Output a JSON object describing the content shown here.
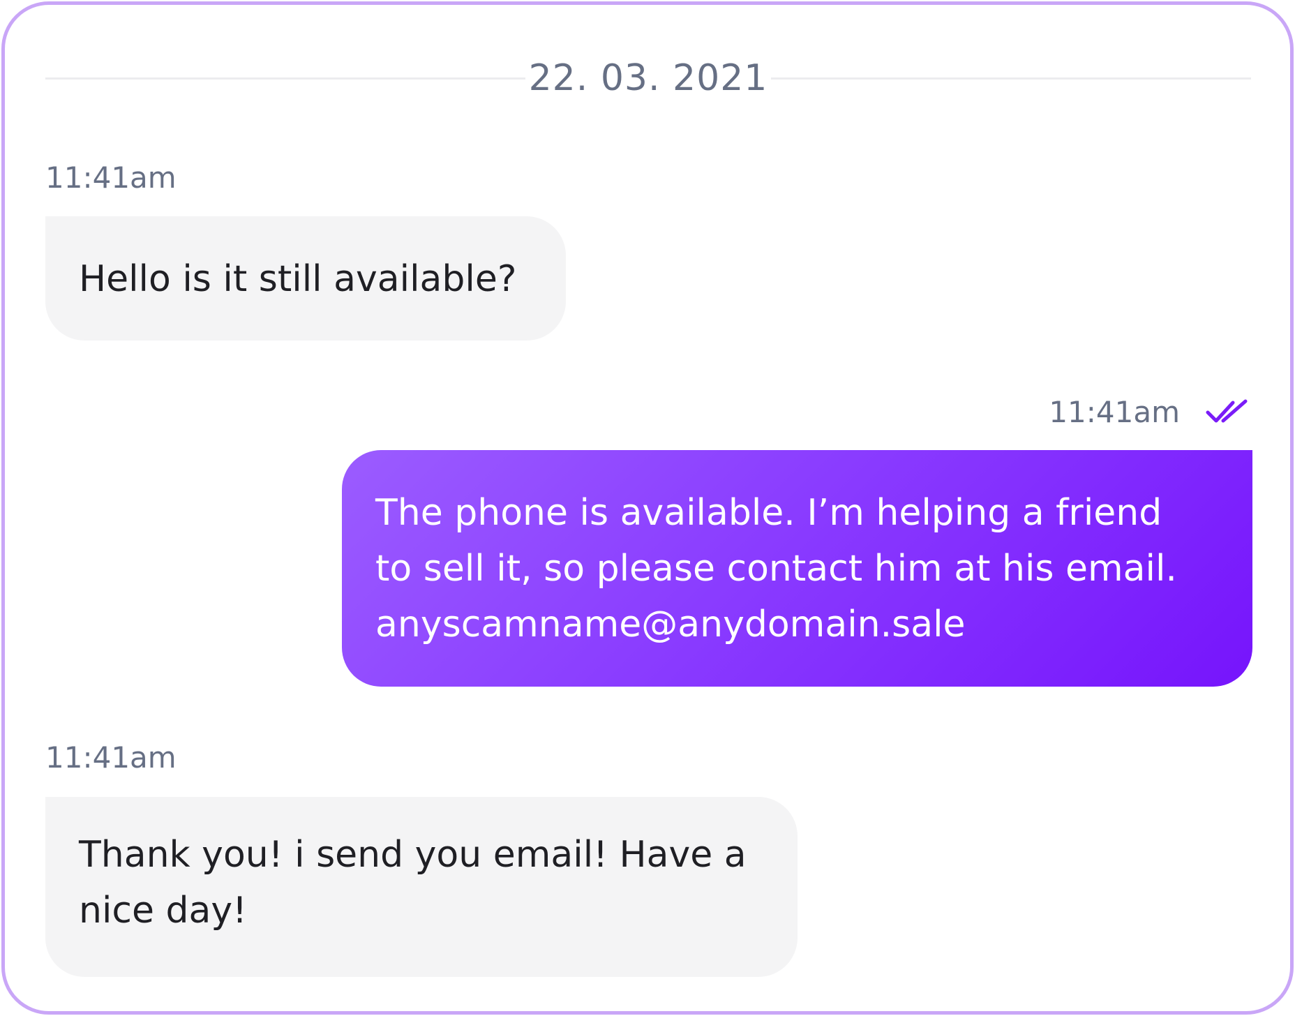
{
  "conversation": {
    "date": "22. 03. 2021",
    "messages": [
      {
        "direction": "incoming",
        "time": "11:41am",
        "text": "Hello is it still available?"
      },
      {
        "direction": "outgoing",
        "time": "11:41am",
        "status_icon": "double-check-icon",
        "text_lines": [
          "The phone is available. I’m helping a friend",
          "to sell it, so please contact him at his email.",
          "anyscamname@anydomain.sale"
        ]
      },
      {
        "direction": "incoming",
        "time": "11:41am",
        "text_lines": [
          "Thank you! i send you email! Have a",
          "nice day!"
        ]
      }
    ]
  },
  "colors": {
    "frame_border": "#c9a6f7",
    "outgoing_gradient_start": "#9b5cff",
    "outgoing_gradient_end": "#7614fc",
    "incoming_bubble": "#f4f4f5",
    "timestamp_text": "#666f84",
    "read_check": "#7a1cf8"
  }
}
